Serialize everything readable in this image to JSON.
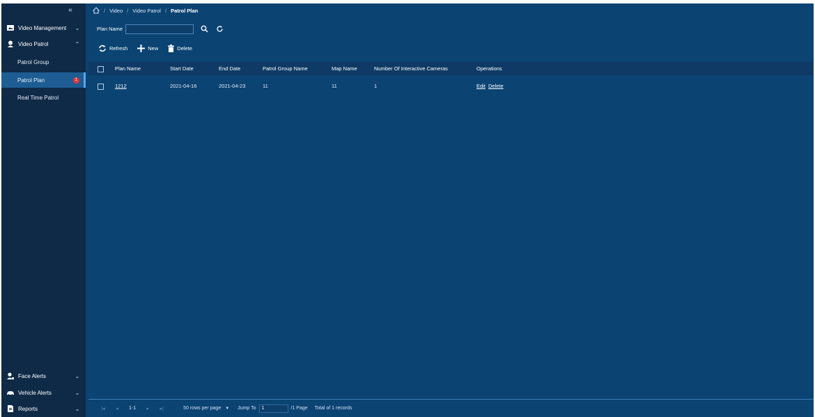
{
  "breadcrumb": {
    "items": [
      "Video",
      "Video Patrol",
      "Patrol Plan"
    ]
  },
  "sidebar": {
    "groups": [
      {
        "label": "Video Management",
        "chevron": "⌄"
      },
      {
        "label": "Video Patrol",
        "chevron": "⌃"
      },
      {
        "label": "Face Alerts",
        "chevron": "⌄"
      },
      {
        "label": "Vehicle Alerts",
        "chevron": "⌄"
      },
      {
        "label": "Reports",
        "chevron": "⌄"
      }
    ],
    "subitems": [
      {
        "label": "Patrol Group"
      },
      {
        "label": "Patrol Plan",
        "badge": "1"
      },
      {
        "label": "Real Time Patrol"
      }
    ],
    "collapse": "«"
  },
  "search": {
    "label": "Plan Name",
    "value": "",
    "placeholder": ""
  },
  "toolbar": {
    "refresh": "Refresh",
    "new": "New",
    "delete": "Delete"
  },
  "table": {
    "headers": [
      "Plan Name",
      "Start Date",
      "End Date",
      "Patrol Group Name",
      "Map Name",
      "Number Of Interactive Cameras",
      "Operations"
    ],
    "rows": [
      {
        "plan_name": "1212",
        "start_date": "2021-04-16",
        "end_date": "2021-04-23",
        "patrol_group": "11",
        "map_name": "11",
        "cameras": "1",
        "edit": "Edit",
        "delete": "Delete"
      }
    ]
  },
  "pagination": {
    "page_range": "1-1",
    "rows_per_page": "50 rows per page",
    "jump_label": "Jump To",
    "jump_value": "1",
    "page_suffix": "/1 Page",
    "total": "Total of 1 records"
  },
  "colors": {
    "background": "#0b4372",
    "sidebar": "#0f2a47",
    "active_item": "#1d5d93",
    "badge": "#e5383b"
  }
}
